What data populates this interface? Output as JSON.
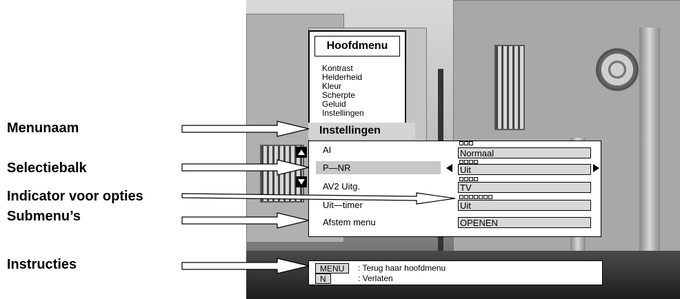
{
  "annotations": {
    "menunaam": "Menunaam",
    "selectiebalk": "Selectiebalk",
    "indicator": "Indicator voor opties",
    "submenus": "Submenu’s",
    "instructies": "Instructies"
  },
  "main_menu": {
    "title": "Hoofdmenu",
    "items": [
      "Kontrast",
      "Helderheid",
      "Kleur",
      "Scherpte",
      "Geluid",
      "Instellingen"
    ]
  },
  "settings": {
    "title": "Instellingen",
    "rows": [
      {
        "label": "AI",
        "value": "Normaal",
        "options_count": 3,
        "selected": false
      },
      {
        "label": "P—NR",
        "value": "Uit",
        "options_count": 4,
        "selected": true
      },
      {
        "label": "AV2 Uitg.",
        "value": "TV",
        "options_count": 4,
        "selected": false
      },
      {
        "label": "Uit—timer",
        "value": "Uit",
        "options_count": 7,
        "selected": false
      },
      {
        "label": "Afstem menu",
        "value": "OPENEN",
        "options_count": 0,
        "selected": false
      }
    ]
  },
  "instructions": [
    {
      "key": "MENU",
      "text": ": Terug haar hoofdmenu"
    },
    {
      "key": "N",
      "text": ": Verlaten"
    }
  ]
}
